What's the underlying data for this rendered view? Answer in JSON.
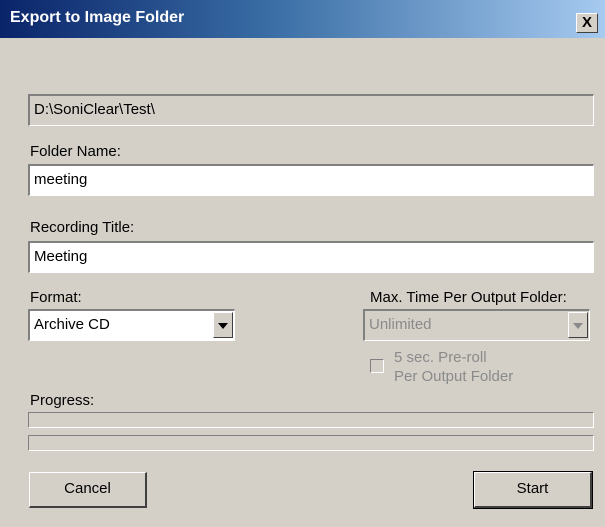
{
  "window": {
    "title": "Export to Image Folder",
    "close_label": "X"
  },
  "path": {
    "value": "D:\\SoniClear\\Test\\"
  },
  "folder_name": {
    "label": "Folder Name:",
    "value": "meeting"
  },
  "recording_title": {
    "label": "Recording Title:",
    "value": "Meeting"
  },
  "format": {
    "label": "Format:",
    "selected": "Archive CD"
  },
  "max_time": {
    "label": "Max. Time Per Output Folder:",
    "selected": "Unlimited"
  },
  "preroll": {
    "line1": "5 sec. Pre-roll",
    "line2": "Per Output Folder",
    "checked": false
  },
  "progress": {
    "label": "Progress:",
    "bar1": 0,
    "bar2": 0
  },
  "buttons": {
    "cancel": "Cancel",
    "start": "Start"
  }
}
